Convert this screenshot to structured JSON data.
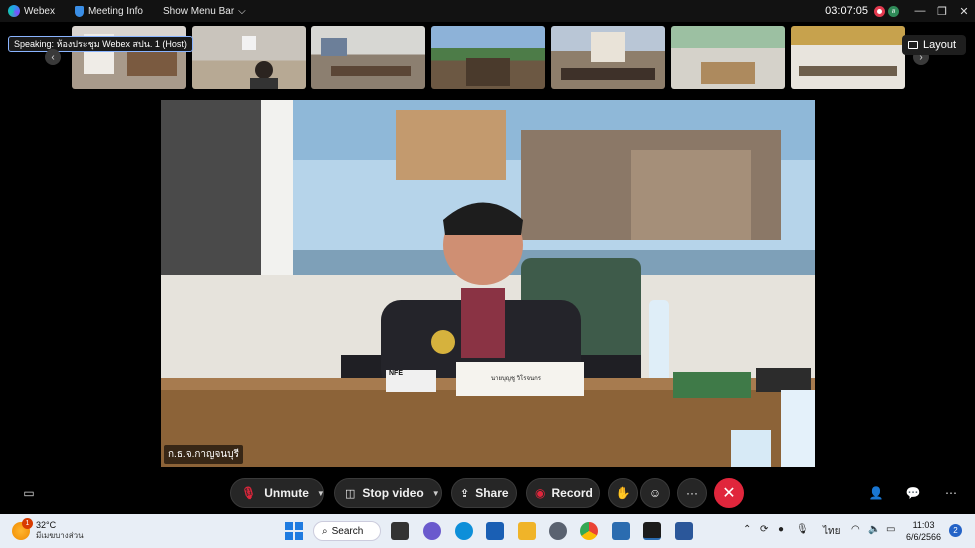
{
  "titlebar": {
    "app_name": "Webex",
    "meeting_info": "Meeting Info",
    "show_menu_bar": "Show Menu Bar",
    "time": "03:07:05",
    "user_initial": "ส"
  },
  "speaking": "Speaking: ห้องประชุม Webex สปน. 1 (Host)",
  "layout_label": "Layout",
  "main_video": {
    "participant_name": "ก.ธ.จ.กาญจนบุรี",
    "mic_label": "NFE",
    "nameplate": "นายบุญชู วิโรจนกร"
  },
  "controls": {
    "unmute": "Unmute",
    "stop_video": "Stop video",
    "share": "Share",
    "record": "Record",
    "more": "···"
  },
  "taskbar": {
    "temperature": "32°C",
    "weather_desc": "มีเมฆบางส่วน",
    "weather_badge": "1",
    "search_label": "Search",
    "language": "ไทย",
    "clock_time": "11:03",
    "clock_date": "6/6/2566",
    "notification_count": "2"
  }
}
